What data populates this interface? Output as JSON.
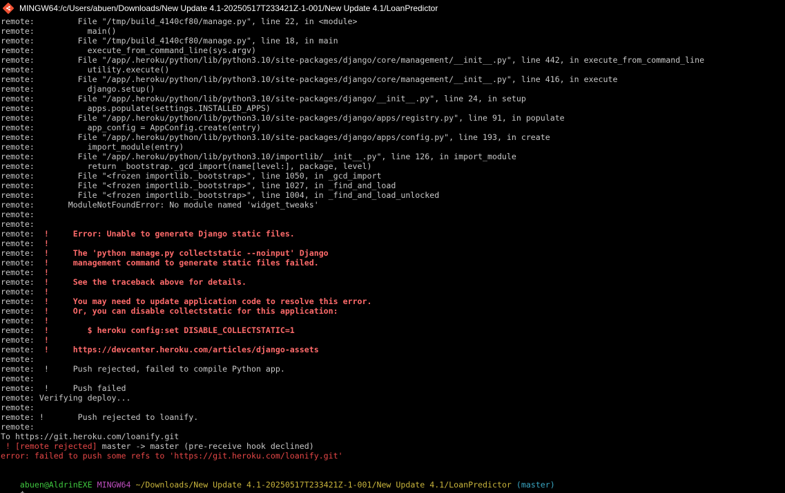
{
  "window": {
    "title": "MINGW64:/c/Users/abuen/Downloads/New Update 4.1-20250517T233421Z-1-001/New Update 4.1/LoanPredictor",
    "icon": "git-bash-icon"
  },
  "colors": {
    "background": "#000000",
    "text": "#c8c8c8",
    "error_text": "#ff6b6b",
    "prompt_user": "#3fc83f",
    "prompt_env": "#c04fc0",
    "prompt_path": "#c8b43c",
    "prompt_branch": "#3aa7c4"
  },
  "terminal": {
    "lines": [
      {
        "text": "remote:         File \"/tmp/build_4140cf80/manage.py\", line 22, in <module>",
        "style": "normal"
      },
      {
        "text": "remote:           main()",
        "style": "normal"
      },
      {
        "text": "remote:         File \"/tmp/build_4140cf80/manage.py\", line 18, in main",
        "style": "normal"
      },
      {
        "text": "remote:           execute_from_command_line(sys.argv)",
        "style": "normal"
      },
      {
        "text": "remote:         File \"/app/.heroku/python/lib/python3.10/site-packages/django/core/management/__init__.py\", line 442, in execute_from_command_line",
        "style": "normal"
      },
      {
        "text": "remote:           utility.execute()",
        "style": "normal"
      },
      {
        "text": "remote:         File \"/app/.heroku/python/lib/python3.10/site-packages/django/core/management/__init__.py\", line 416, in execute",
        "style": "normal"
      },
      {
        "text": "remote:           django.setup()",
        "style": "normal"
      },
      {
        "text": "remote:         File \"/app/.heroku/python/lib/python3.10/site-packages/django/__init__.py\", line 24, in setup",
        "style": "normal"
      },
      {
        "text": "remote:           apps.populate(settings.INSTALLED_APPS)",
        "style": "normal"
      },
      {
        "text": "remote:         File \"/app/.heroku/python/lib/python3.10/site-packages/django/apps/registry.py\", line 91, in populate",
        "style": "normal"
      },
      {
        "text": "remote:           app_config = AppConfig.create(entry)",
        "style": "normal"
      },
      {
        "text": "remote:         File \"/app/.heroku/python/lib/python3.10/site-packages/django/apps/config.py\", line 193, in create",
        "style": "normal"
      },
      {
        "text": "remote:           import_module(entry)",
        "style": "normal"
      },
      {
        "text": "remote:         File \"/app/.heroku/python/lib/python3.10/importlib/__init__.py\", line 126, in import_module",
        "style": "normal"
      },
      {
        "text": "remote:           return _bootstrap._gcd_import(name[level:], package, level)",
        "style": "normal"
      },
      {
        "text": "remote:         File \"<frozen importlib._bootstrap>\", line 1050, in _gcd_import",
        "style": "normal"
      },
      {
        "text": "remote:         File \"<frozen importlib._bootstrap>\", line 1027, in _find_and_load",
        "style": "normal"
      },
      {
        "text": "remote:         File \"<frozen importlib._bootstrap>\", line 1004, in _find_and_load_unlocked",
        "style": "normal"
      },
      {
        "text": "remote:       ModuleNotFoundError: No module named 'widget_tweaks'",
        "style": "normal"
      },
      {
        "text": "remote:",
        "style": "normal"
      },
      {
        "text": "remote:",
        "style": "normal"
      },
      {
        "prefix": "remote:  ",
        "text": "!     Error: Unable to generate Django static files.",
        "style": "error"
      },
      {
        "prefix": "remote:  ",
        "text": "!",
        "style": "error"
      },
      {
        "prefix": "remote:  ",
        "text": "!     The 'python manage.py collectstatic --noinput' Django",
        "style": "error"
      },
      {
        "prefix": "remote:  ",
        "text": "!     management command to generate static files failed.",
        "style": "error"
      },
      {
        "prefix": "remote:  ",
        "text": "!",
        "style": "error"
      },
      {
        "prefix": "remote:  ",
        "text": "!     See the traceback above for details.",
        "style": "error"
      },
      {
        "prefix": "remote:  ",
        "text": "!",
        "style": "error"
      },
      {
        "prefix": "remote:  ",
        "text": "!     You may need to update application code to resolve this error.",
        "style": "error"
      },
      {
        "prefix": "remote:  ",
        "text": "!     Or, you can disable collectstatic for this application:",
        "style": "error"
      },
      {
        "prefix": "remote:  ",
        "text": "!",
        "style": "error"
      },
      {
        "prefix": "remote:  ",
        "text": "!        $ heroku config:set DISABLE_COLLECTSTATIC=1",
        "style": "error"
      },
      {
        "prefix": "remote:  ",
        "text": "!",
        "style": "error"
      },
      {
        "prefix": "remote:  ",
        "text": "!     https://devcenter.heroku.com/articles/django-assets",
        "style": "error"
      },
      {
        "text": "remote:",
        "style": "normal"
      },
      {
        "text": "remote:  !     Push rejected, failed to compile Python app.",
        "style": "normal"
      },
      {
        "text": "remote:",
        "style": "normal"
      },
      {
        "text": "remote:  !     Push failed",
        "style": "normal"
      },
      {
        "text": "remote: Verifying deploy...",
        "style": "normal"
      },
      {
        "text": "remote:",
        "style": "normal"
      },
      {
        "text": "remote: !       Push rejected to loanify.",
        "style": "normal"
      },
      {
        "text": "remote:",
        "style": "normal"
      },
      {
        "text": "To https://git.heroku.com/loanify.git",
        "style": "normal"
      },
      {
        "prefix": " ! [remote rejected]",
        "text": " master -> master (pre-receive hook declined)",
        "style": "rejected"
      },
      {
        "text": "error: failed to push some refs to 'https://git.heroku.com/loanify.git'",
        "style": "red"
      },
      {
        "text": "",
        "style": "normal"
      }
    ],
    "prompt": {
      "user_host": "abuen@AldrinEXE",
      "env": "MINGW64",
      "path": "~/Downloads/New Update 4.1-20250517T233421Z-1-001/New Update 4.1/LoanPredictor",
      "branch": "(master)",
      "symbol": "$"
    }
  }
}
